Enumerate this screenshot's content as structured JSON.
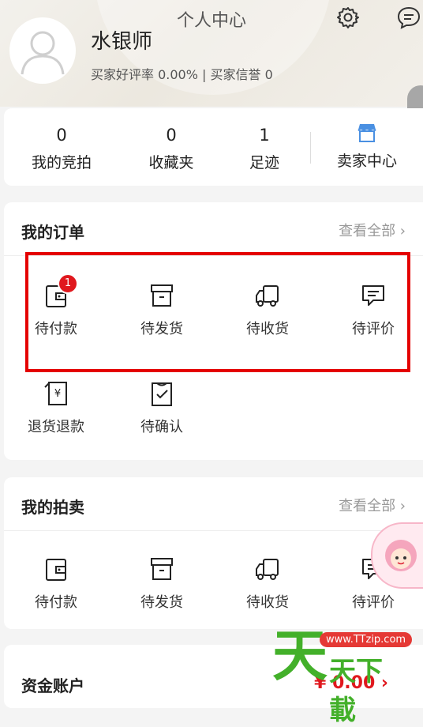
{
  "header": {
    "title": "个人中心"
  },
  "user": {
    "name": "水银师",
    "stats_line": "买家好评率 0.00% | 买家信誉 0"
  },
  "summary": [
    {
      "value": "0",
      "label": "我的竞拍"
    },
    {
      "value": "0",
      "label": "收藏夹"
    },
    {
      "value": "1",
      "label": "足迹"
    }
  ],
  "seller_center": {
    "label": "卖家中心"
  },
  "orders": {
    "title": "我的订单",
    "more": "查看全部 ›",
    "items": [
      {
        "label": "待付款",
        "icon": "wallet-icon",
        "badge": "1"
      },
      {
        "label": "待发货",
        "icon": "box-icon"
      },
      {
        "label": "待收货",
        "icon": "truck-icon"
      },
      {
        "label": "待评价",
        "icon": "comment-icon"
      },
      {
        "label": "退货退款",
        "icon": "refund-icon"
      },
      {
        "label": "待确认",
        "icon": "clipboard-check-icon"
      }
    ]
  },
  "auctions": {
    "title": "我的拍卖",
    "more": "查看全部 ›",
    "items": [
      {
        "label": "待付款",
        "icon": "wallet-icon"
      },
      {
        "label": "待发货",
        "icon": "box-icon"
      },
      {
        "label": "待收货",
        "icon": "truck-icon"
      },
      {
        "label": "待评价",
        "icon": "comment-icon"
      }
    ]
  },
  "account": {
    "title": "资金账户",
    "balance": "¥ 0.00 ›"
  },
  "watermark": {
    "big": "天",
    "small": "天下載",
    "url": "www.TTzip.com"
  },
  "colors": {
    "badge": "#e0181e",
    "highlight_box": "#e40000",
    "watermark_green": "#43b02a"
  }
}
